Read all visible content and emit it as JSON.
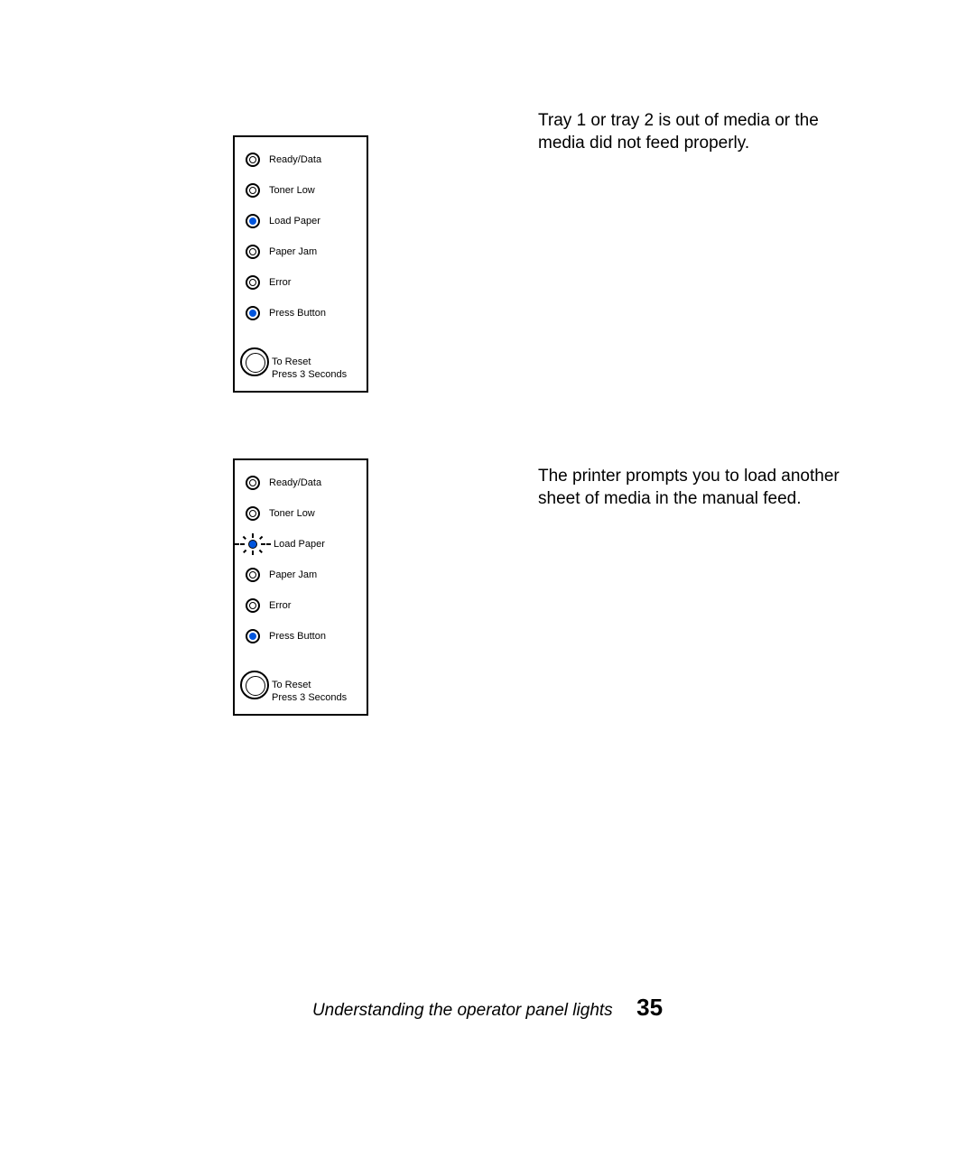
{
  "panel1": {
    "leds": [
      {
        "label": "Ready/Data",
        "state": "off"
      },
      {
        "label": "Toner Low",
        "state": "off"
      },
      {
        "label": "Load Paper",
        "state": "on"
      },
      {
        "label": "Paper Jam",
        "state": "off"
      },
      {
        "label": "Error",
        "state": "off"
      },
      {
        "label": "Press Button",
        "state": "on"
      }
    ],
    "reset_line1": "To Reset",
    "reset_line2": "Press 3 Seconds"
  },
  "panel2": {
    "leds": [
      {
        "label": "Ready/Data",
        "state": "off"
      },
      {
        "label": "Toner Low",
        "state": "off"
      },
      {
        "label": "Load Paper",
        "state": "blink"
      },
      {
        "label": "Paper Jam",
        "state": "off"
      },
      {
        "label": "Error",
        "state": "off"
      },
      {
        "label": "Press Button",
        "state": "on"
      }
    ],
    "reset_line1": "To Reset",
    "reset_line2": "Press 3 Seconds"
  },
  "desc1": "Tray 1 or tray 2 is out of media or the media did not feed properly.",
  "desc2": "The printer prompts you to load another sheet of media in the manual feed.",
  "footer_title": "Understanding the operator panel lights",
  "page_number": "35"
}
